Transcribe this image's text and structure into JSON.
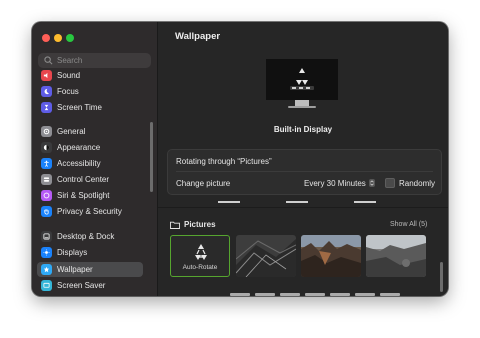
{
  "window": {
    "traffic_lights": [
      "close",
      "minimize",
      "zoom"
    ]
  },
  "sidebar": {
    "search_placeholder": "Search",
    "items": [
      {
        "label": "Sound",
        "icon": "speaker-icon",
        "color": "#e8464d"
      },
      {
        "label": "Focus",
        "icon": "moon-icon",
        "color": "#5e5ce6"
      },
      {
        "label": "Screen Time",
        "icon": "hourglass-icon",
        "color": "#5e5ce6"
      },
      {
        "label": "General",
        "icon": "gear-icon",
        "color": "#8e8e93"
      },
      {
        "label": "Appearance",
        "icon": "appearance-icon",
        "color": "#3a3a3c"
      },
      {
        "label": "Accessibility",
        "icon": "accessibility-icon",
        "color": "#1a82fb"
      },
      {
        "label": "Control Center",
        "icon": "control-center-icon",
        "color": "#8e8e93"
      },
      {
        "label": "Siri & Spotlight",
        "icon": "siri-icon",
        "color": "#b65af5"
      },
      {
        "label": "Privacy & Security",
        "icon": "hand-icon",
        "color": "#1a82fb"
      },
      {
        "label": "Desktop & Dock",
        "icon": "dock-icon",
        "color": "#3a3a3c"
      },
      {
        "label": "Displays",
        "icon": "display-icon",
        "color": "#1a82fb"
      },
      {
        "label": "Wallpaper",
        "icon": "wallpaper-icon",
        "color": "#2fa9f5",
        "selected": true
      },
      {
        "label": "Screen Saver",
        "icon": "screen-saver-icon",
        "color": "#35b6d8"
      }
    ]
  },
  "main": {
    "title": "Wallpaper",
    "display_label": "Built-in Display",
    "rotating_label": "Rotating through “Pictures”",
    "change_picture_label": "Change picture",
    "interval_value": "Every 30 Minutes",
    "randomly_label": "Randomly",
    "randomly_checked": false,
    "pictures_header": "Pictures",
    "show_all_label": "Show All (5)",
    "thumbnails": [
      {
        "label": "Auto-Rotate",
        "selected": true
      },
      {
        "label": ""
      },
      {
        "label": ""
      },
      {
        "label": ""
      }
    ]
  },
  "colors": {
    "accent_selected": "#56a52f",
    "selection_bg": "#4a4a4c"
  }
}
